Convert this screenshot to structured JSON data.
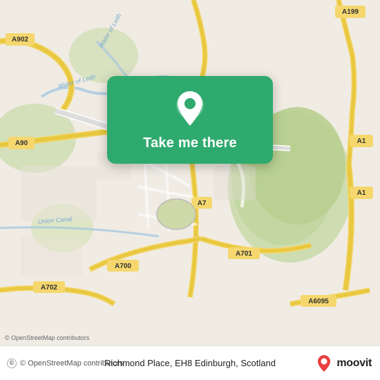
{
  "map": {
    "alt": "OpenStreetMap of Edinburgh area around Richmond Place",
    "center_lat": 55.945,
    "center_lng": -3.19
  },
  "cta": {
    "button_label": "Take me there",
    "pin_icon": "location-pin-icon"
  },
  "bottom_bar": {
    "osm_credit": "© OpenStreetMap contributors",
    "location_text": "Richmond Place, EH8 Edinburgh, Scotland",
    "moovit_brand": "moovit"
  }
}
